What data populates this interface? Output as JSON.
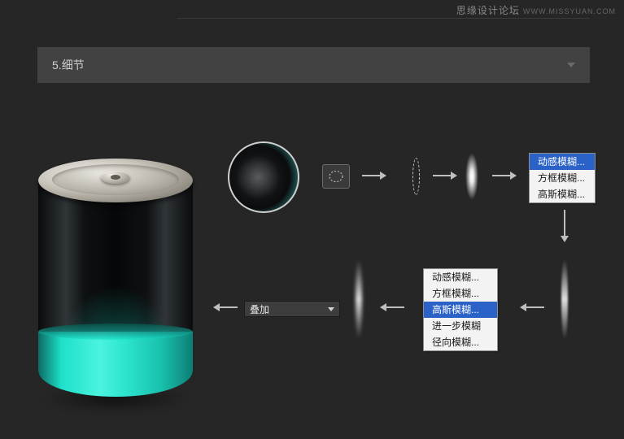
{
  "watermark": {
    "cn": "思缘设计论坛",
    "en": "WWW.MISSYUAN.COM"
  },
  "section": {
    "number": "5.",
    "title": "细节"
  },
  "dropdown": {
    "label": "叠加"
  },
  "menu_top": {
    "items": [
      "动感模糊...",
      "方框模糊...",
      "高斯模糊..."
    ],
    "selected_index": 0
  },
  "menu_bottom": {
    "items": [
      "动感模糊...",
      "方框模糊...",
      "高斯模糊...",
      "进一步模糊",
      "径向模糊..."
    ],
    "selected_index": 2
  },
  "icons": {
    "selection_tool": "elliptical-marquee"
  }
}
